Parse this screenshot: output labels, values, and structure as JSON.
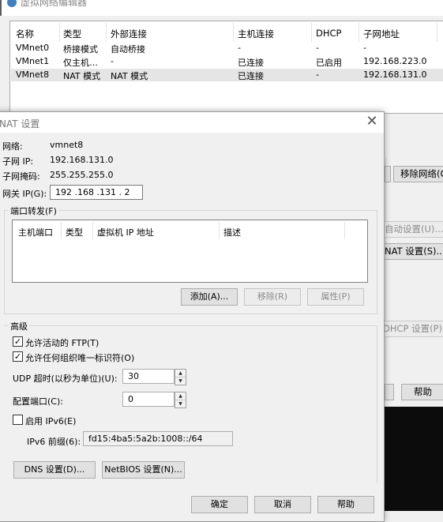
{
  "background_window": {
    "title": "虚拟网络编辑器",
    "columns": [
      "名称",
      "类型",
      "外部连接",
      "主机连接",
      "DHCP",
      "子网地址"
    ],
    "rows": [
      {
        "name": "VMnet0",
        "type": "桥接模式",
        "external": "自动桥接",
        "host": "-",
        "dhcp": "-",
        "subnet": "-"
      },
      {
        "name": "VMnet1",
        "type": "仅主机…",
        "external": "-",
        "host": "已连接",
        "dhcp": "已启用",
        "subnet": "192.168.223.0"
      },
      {
        "name": "VMnet8",
        "type": "NAT 模式",
        "external": "NAT 模式",
        "host": "已连接",
        "dhcp": "-",
        "subnet": "192.168.131.0"
      }
    ],
    "buttons": {
      "remove_network": "移除网络(O)",
      "auto_settings": "自动设置(U)...",
      "nat_settings": "NAT 设置(S)...",
      "dhcp_settings": "DHCP 设置(P)...",
      "help": "帮助"
    }
  },
  "nat_dialog": {
    "title": "NAT 设置",
    "network_label": "网络:",
    "network_value": "vmnet8",
    "subnet_ip_label": "子网 IP:",
    "subnet_ip_value": "192.168.131.0",
    "subnet_mask_label": "子网掩码:",
    "subnet_mask_value": "255.255.255.0",
    "gateway_label": "网关 IP(G):",
    "gateway_value": "192 .168 .131 . 2",
    "port_forwarding": {
      "title": "端口转发(F)",
      "columns": [
        "主机端口",
        "类型",
        "虚拟机 IP 地址",
        "描述"
      ],
      "rows": [],
      "add": "添加(A)...",
      "remove": "移除(R)",
      "properties": "属性(P)"
    },
    "advanced": {
      "title": "高级",
      "allow_ftp": "允许活动的 FTP(T)",
      "allow_ftp_checked": true,
      "allow_oui": "允许任何组织唯一标识符(O)",
      "allow_oui_checked": true,
      "udp_timeout_label": "UDP 超时(以秒为单位)(U):",
      "udp_timeout_value": "30",
      "config_port_label": "配置端口(C):",
      "config_port_value": "0",
      "enable_ipv6": "启用 IPv6(E)",
      "enable_ipv6_checked": false,
      "ipv6_prefix_label": "IPv6 前缀(6):",
      "ipv6_prefix_value": "fd15:4ba5:5a2b:1008::/64",
      "dns_settings": "DNS 设置(D)...",
      "netbios_settings": "NetBIOS 设置(N)..."
    },
    "buttons": {
      "ok": "确定",
      "cancel": "取消",
      "help": "帮助"
    }
  }
}
